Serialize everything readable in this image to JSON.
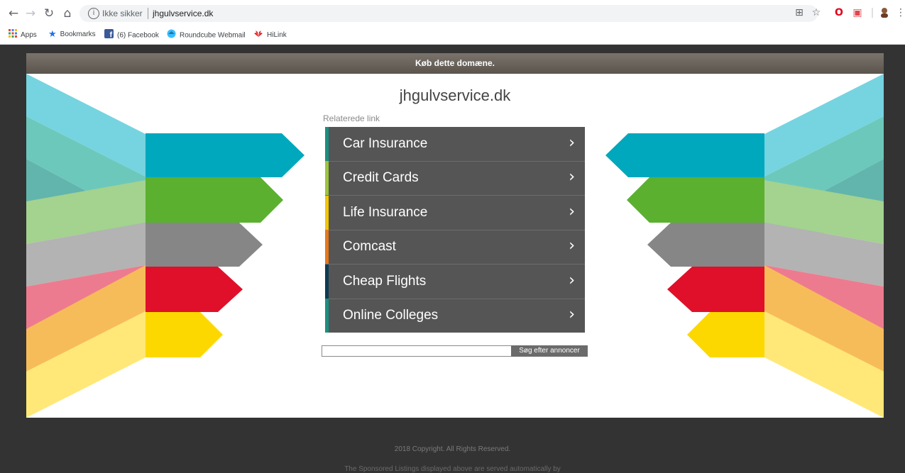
{
  "browser": {
    "security_label": "Ikke sikker",
    "url": "jhgulvservice.dk",
    "bookmarks": [
      {
        "label": "Apps",
        "icon": "apps-grid-icon"
      },
      {
        "label": "Bookmarks",
        "icon": "star-icon"
      },
      {
        "label": "(6) Facebook",
        "icon": "facebook-icon"
      },
      {
        "label": "Roundcube Webmail",
        "icon": "roundcube-icon"
      },
      {
        "label": "HiLink",
        "icon": "huawei-icon"
      }
    ]
  },
  "page": {
    "banner": "Køb dette domæne.",
    "site_title": "jhgulvservice.dk",
    "related_label": "Relaterede link",
    "links": [
      {
        "label": "Car Insurance",
        "color": "#1a8f7f"
      },
      {
        "label": "Credit Cards",
        "color": "#9bc53d"
      },
      {
        "label": "Life Insurance",
        "color": "#f2c500"
      },
      {
        "label": "Comcast",
        "color": "#e8761b"
      },
      {
        "label": "Cheap Flights",
        "color": "#0d3b54"
      },
      {
        "label": "Online Colleges",
        "color": "#1a8f7f"
      }
    ],
    "search_input_value": "",
    "search_button": "Søg efter annoncer",
    "footer_copyright": "2018 Copyright. All Rights Reserved.",
    "footer_disclaimer": "The Sponsored Listings displayed above are served automatically by"
  },
  "colors": {
    "arrow_teal": "#00a8bd",
    "arrow_green": "#5bb030",
    "arrow_gray": "#868686",
    "arrow_red": "#e0102a",
    "arrow_yellow": "#fcd800"
  }
}
